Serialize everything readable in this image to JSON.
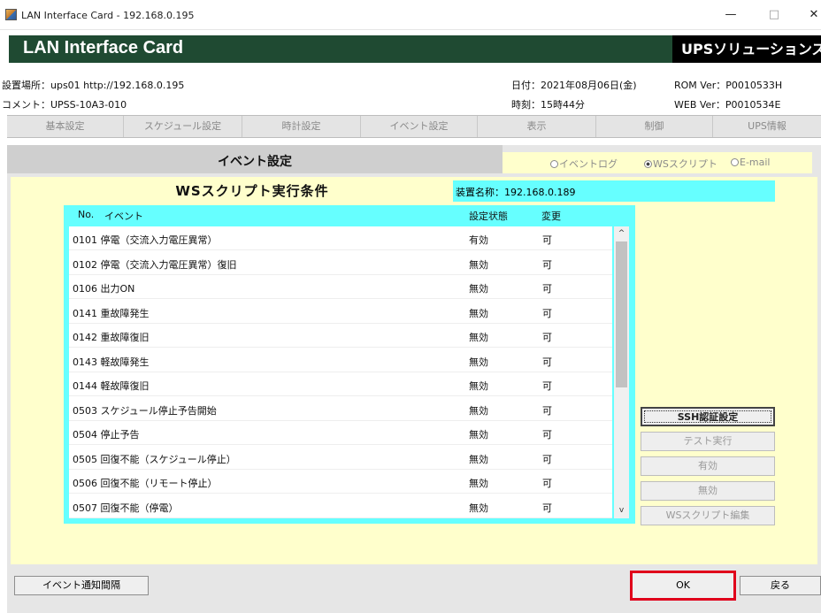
{
  "window": {
    "title": "LAN Interface Card - 192.168.0.195",
    "minimize": "—",
    "maximize": "□",
    "close": "✕"
  },
  "banner": {
    "product": "LAN Interface Card",
    "company": "UPSソリューションズ"
  },
  "info": {
    "location": "設置場所：ups01 http://192.168.0.195",
    "comment": "コメント：UPSS-10A3-010",
    "date": "日付：2021年08月06日(金)",
    "time": "時刻：15時44分",
    "rom_ver": "ROM Ver：P0010533H",
    "web_ver": "WEB Ver：P0010534E"
  },
  "nav": [
    "基本設定",
    "スケジュール設定",
    "時計設定",
    "イベント設定",
    "表示",
    "制御",
    "UPS情報"
  ],
  "section": {
    "title": "イベント設定",
    "radios": [
      {
        "label": "イベントログ",
        "checked": false
      },
      {
        "label": "WSスクリプト",
        "checked": true
      },
      {
        "label": "E-mail",
        "checked": false
      }
    ]
  },
  "conditions": {
    "title": "WSスクリプト実行条件",
    "device_name": "装置名称：192.168.0.189",
    "headers": {
      "no": "No.",
      "event": "イベント",
      "state": "設定状態",
      "change": "変更"
    },
    "rows": [
      {
        "name": "0101 停電（交流入力電圧異常）",
        "state": "有効",
        "change": "可"
      },
      {
        "name": "0102 停電（交流入力電圧異常）復旧",
        "state": "無効",
        "change": "可"
      },
      {
        "name": "0106 出力ON",
        "state": "無効",
        "change": "可"
      },
      {
        "name": "0141 重故障発生",
        "state": "無効",
        "change": "可"
      },
      {
        "name": "0142 重故障復旧",
        "state": "無効",
        "change": "可"
      },
      {
        "name": "0143 軽故障発生",
        "state": "無効",
        "change": "可"
      },
      {
        "name": "0144 軽故障復旧",
        "state": "無効",
        "change": "可"
      },
      {
        "name": "0503 スケジュール停止予告開始",
        "state": "無効",
        "change": "可"
      },
      {
        "name": "0504 停止予告",
        "state": "無効",
        "change": "可"
      },
      {
        "name": "0505 回復不能（スケジュール停止）",
        "state": "無効",
        "change": "可"
      },
      {
        "name": "0506 回復不能（リモート停止）",
        "state": "無効",
        "change": "可"
      },
      {
        "name": "0507 回復不能（停電）",
        "state": "無効",
        "change": "可"
      }
    ]
  },
  "actions": {
    "ssh": "SSH認証設定",
    "test": "テスト実行",
    "enable": "有効",
    "disable": "無効",
    "edit": "WSスクリプト編集",
    "interval": "イベント通知間隔",
    "ok": "OK",
    "back": "戻る"
  },
  "scroll": {
    "up": "^",
    "down": "v"
  },
  "colors": {
    "banner": "#1f4a32",
    "cream": "#ffffcc",
    "cyan": "#66ffff",
    "highlight": "#e0001b"
  }
}
